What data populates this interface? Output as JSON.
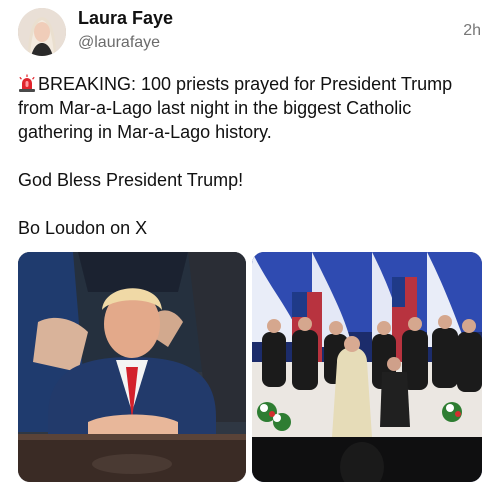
{
  "post": {
    "author_name": "Laura Faye",
    "author_handle": "@laurafaye",
    "timestamp": "2h",
    "paragraphs": [
      "BREAKING: 100 priests prayed for President Trump from Mar-a-Lago last night in the biggest Catholic gathering in Mar-a-Lago history.",
      "God Bless President Trump!",
      "Bo Loudon on X"
    ],
    "leading_emoji": "siren-icon",
    "media": [
      {
        "kind": "photo",
        "name": "photo-prayer-desk"
      },
      {
        "kind": "photo",
        "name": "photo-priests-gathering"
      }
    ]
  },
  "colors": {
    "text": "#111111",
    "secondary_text": "#6b6b6b",
    "siren_red": "#e0242c"
  }
}
